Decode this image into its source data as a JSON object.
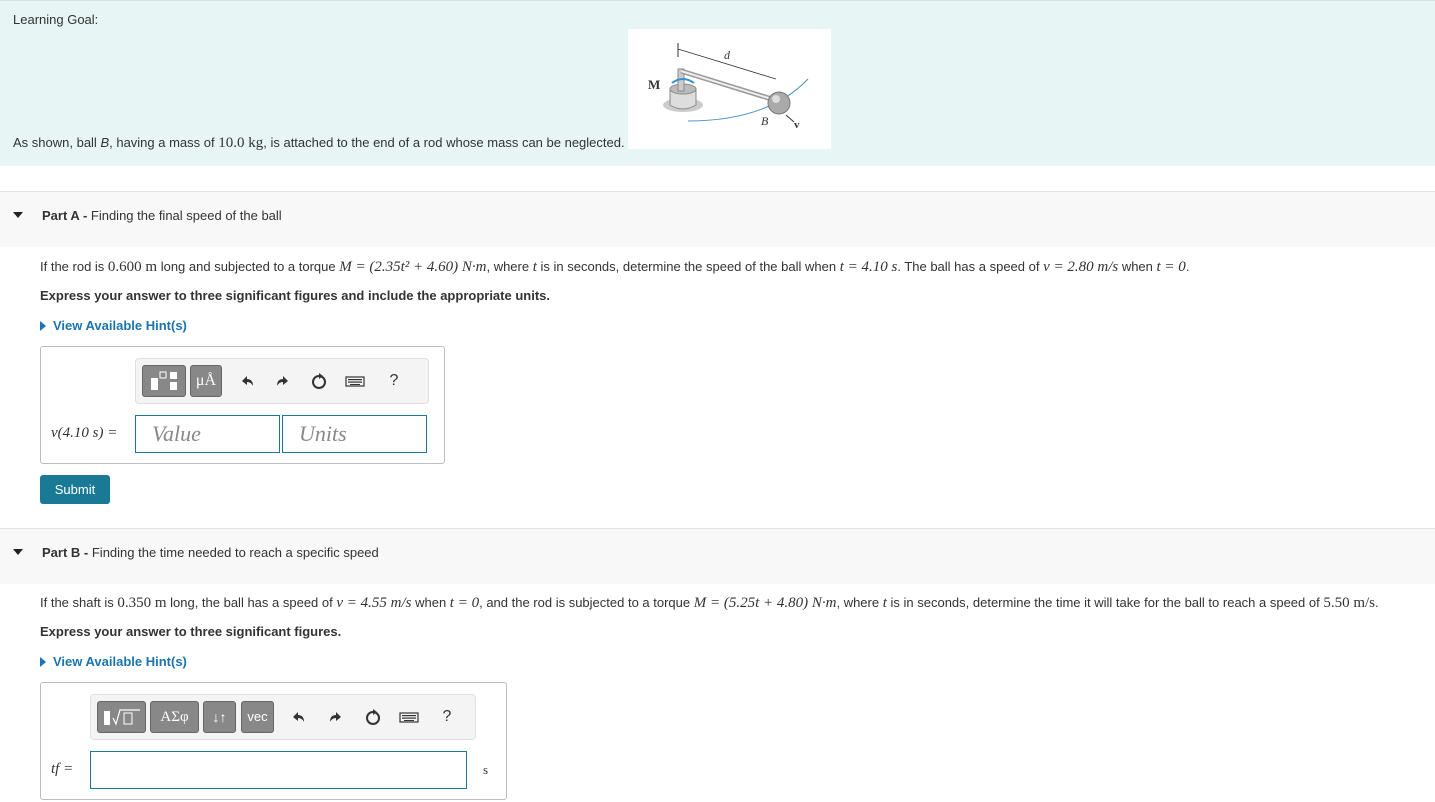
{
  "learning_goal": {
    "title": "Learning Goal:",
    "text_before": "As shown, ball ",
    "ball_name": "B",
    "text_mass_prefix": ", having a mass of ",
    "mass": "10.0 kg",
    "text_after": ", is attached to the end of a rod whose mass can be neglected.",
    "figure_labels": {
      "moment": "M",
      "distance": "d",
      "ball": "B",
      "velocity": "v"
    }
  },
  "part_a": {
    "label": "Part A",
    "title": "Finding the final speed of the ball",
    "problem": {
      "p1": "If the rod is ",
      "length": "0.600 m",
      "p2": " long and subjected to a torque ",
      "torque": "M = (2.35t² + 4.60) N·m",
      "p3": ", where ",
      "t1": "t",
      "p4": " is in seconds, determine the speed of the ball when ",
      "t_when": "t = 4.10 s",
      "p5": ". The ball has a speed of ",
      "v0": "v = 2.80 m/s",
      "p6": " when ",
      "t0": "t = 0",
      "p7": "."
    },
    "instruction": "Express your answer to three significant figures and include the appropriate units.",
    "hint": "View Available Hint(s)",
    "toolbar": {
      "templates": "▯▯",
      "units": "μÅ",
      "help": "?"
    },
    "answer_label": "v(4.10 s) =",
    "value_placeholder": "Value",
    "units_placeholder": "Units",
    "submit": "Submit"
  },
  "part_b": {
    "label": "Part B",
    "title": "Finding the time needed to reach a specific speed",
    "problem": {
      "p1": "If the shaft is ",
      "length": "0.350 m",
      "p2": " long, the ball has a speed of ",
      "v0": "v = 4.55 m/s",
      "p3": " when ",
      "t0": "t = 0",
      "p4": ", and the rod is subjected to a torque ",
      "torque": "M = (5.25t + 4.80) N·m",
      "p5": ", where ",
      "t1": "t",
      "p6": " is in seconds, determine the time it will take for the ball to reach a speed of ",
      "vf": "5.50 m/s",
      "p7": "."
    },
    "instruction": "Express your answer to three significant figures.",
    "hint": "View Available Hint(s)",
    "toolbar": {
      "templates": "▯√▯",
      "greek": "ΑΣφ",
      "arrows": "↓↑",
      "vec": "vec",
      "help": "?"
    },
    "answer_label": "tf =",
    "unit": "s"
  }
}
